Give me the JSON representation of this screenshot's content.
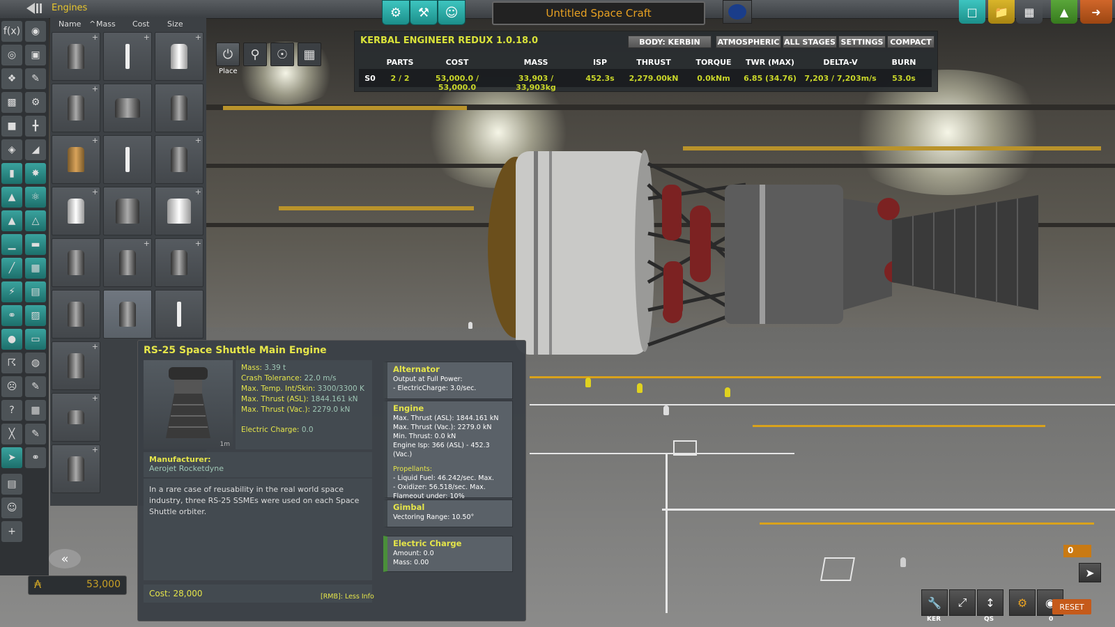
{
  "top": {
    "category_title": "Engines",
    "craft_name": "Untitled Space Craft"
  },
  "sort": {
    "name": "Name",
    "mass": "Mass",
    "cost": "Cost",
    "size": "Size",
    "active_sort_indicator": "^"
  },
  "tools": {
    "place_label": "Place"
  },
  "ker": {
    "title": "KERBAL ENGINEER REDUX 1.0.18.0",
    "buttons": [
      "BODY: KERBIN",
      "ATMOSPHERIC",
      "ALL STAGES",
      "SETTINGS",
      "COMPACT"
    ],
    "headers": [
      "PARTS",
      "COST",
      "MASS",
      "ISP",
      "THRUST",
      "TORQUE",
      "TWR (MAX)",
      "DELTA-V",
      "BURN"
    ],
    "stage": {
      "id": "S0",
      "values": [
        "2 / 2",
        "53,000.0 / 53,000.0",
        "33,903 / 33,903kg",
        "452.3s",
        "2,279.00kN",
        "0.0kNm",
        "6.85 (34.76)",
        "7,203 / 7,203m/s",
        "53.0s"
      ]
    }
  },
  "info": {
    "title": "RS-25 Space Shuttle Main Engine",
    "thumb_size": "1m",
    "stats": [
      {
        "label": "Mass:",
        "value": "3.39 t"
      },
      {
        "label": "Crash Tolerance:",
        "value": "22.0 m/s"
      },
      {
        "label": "Max. Temp. Int/Skin:",
        "value": "3300/3300 K"
      },
      {
        "label": "Max. Thrust (ASL):",
        "value": "1844.161 kN"
      },
      {
        "label": "Max. Thrust (Vac.):",
        "value": "2279.0 kN"
      },
      {
        "label": "Electric Charge:",
        "value": "0.0"
      }
    ],
    "manufacturer_label": "Manufacturer:",
    "manufacturer": "Aerojet Rocketdyne",
    "description": "In a rare case of reusability in the real world space industry, three RS-25 SSMEs were used on each Space Shuttle orbiter.",
    "cost": "Cost: 28,000",
    "rmb": "[RMB]: Less Info",
    "modules": {
      "alternator": {
        "title": "Alternator",
        "lines": [
          "Output at Full Power:",
          "- ElectricCharge: 3.0/sec."
        ]
      },
      "engine": {
        "title": "Engine",
        "lines": [
          "Max. Thrust (ASL): 1844.161 kN",
          "Max. Thrust (Vac.): 2279.0 kN",
          "Min. Thrust: 0.0 kN",
          "Engine Isp: 366 (ASL) - 452.3 (Vac.)"
        ],
        "propellants_label": "Propellants:",
        "propellants": [
          "- Liquid Fuel: 46.242/sec. Max.",
          "- Oxidizer: 56.518/sec. Max.",
          "Flameout under: 10%"
        ]
      },
      "gimbal": {
        "title": "Gimbal",
        "lines": [
          "Vectoring Range: 10.50°"
        ]
      },
      "electric": {
        "title": "Electric Charge",
        "lines": [
          "Amount: 0.0",
          "Mass: 0.00"
        ]
      }
    }
  },
  "bottom": {
    "funds": "53,000",
    "ker_label": "KER",
    "qs_label": "QS",
    "crew_count": "0",
    "stage_number": "0",
    "reset": "RESET"
  },
  "colors": {
    "accent_yellow": "#e5e54a",
    "ker_green": "#c9d62a",
    "teal": "#2fb3ad",
    "craft_name": "#e8a122"
  }
}
